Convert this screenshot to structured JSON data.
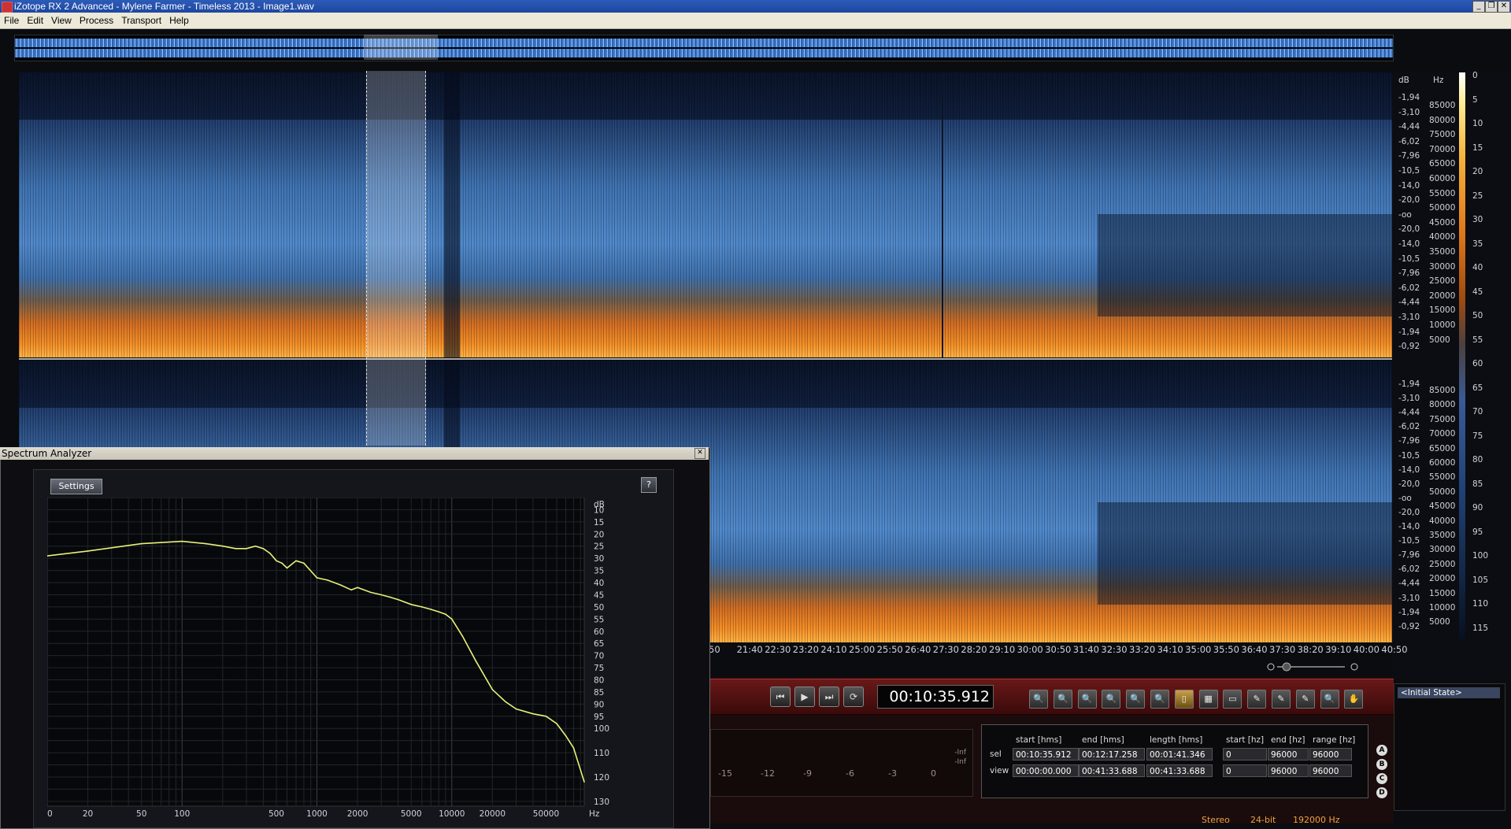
{
  "window": {
    "title": "iZotope RX 2 Advanced - Mylene Farmer - Timeless 2013 - Image1.wav",
    "controls": [
      "_",
      "❐",
      "✕"
    ]
  },
  "menu": [
    "File",
    "Edit",
    "View",
    "Process",
    "Transport",
    "Help"
  ],
  "scale": {
    "db_header": "dB",
    "hz_header": "Hz",
    "db_ticks_top": [
      "-1,94",
      "-3,10",
      "-4,44",
      "-6,02",
      "-7,96",
      "-10,5",
      "-14,0",
      "-20,0",
      "-oo",
      "-20,0",
      "-14,0",
      "-10,5",
      "-7,96",
      "-6,02",
      "-4,44",
      "-3,10",
      "-1,94",
      "-0,92"
    ],
    "db_ticks_bottom": [
      "-1,94",
      "-3,10",
      "-4,44",
      "-6,02",
      "-7,96",
      "-10,5",
      "-14,0",
      "-20,0",
      "-oo",
      "-20,0",
      "-14,0",
      "-10,5",
      "-7,96",
      "-6,02",
      "-4,44",
      "-3,10",
      "-1,94",
      "-0,92"
    ],
    "hz_ticks_top": [
      "85000",
      "80000",
      "75000",
      "70000",
      "65000",
      "60000",
      "55000",
      "50000",
      "45000",
      "40000",
      "35000",
      "30000",
      "25000",
      "20000",
      "15000",
      "10000",
      "5000"
    ],
    "hz_ticks_bottom": [
      "85000",
      "80000",
      "75000",
      "70000",
      "65000",
      "60000",
      "55000",
      "50000",
      "45000",
      "40000",
      "35000",
      "30000",
      "25000",
      "20000",
      "15000",
      "10000",
      "5000"
    ],
    "colorbar_ticks": [
      "0",
      "5",
      "10",
      "15",
      "20",
      "25",
      "30",
      "35",
      "40",
      "45",
      "50",
      "55",
      "60",
      "65",
      "70",
      "75",
      "80",
      "85",
      "90",
      "95",
      "100",
      "105",
      "110",
      "115"
    ]
  },
  "ruler": [
    "50",
    "21:40",
    "22:30",
    "23:20",
    "24:10",
    "25:00",
    "25:50",
    "26:40",
    "27:30",
    "28:20",
    "29:10",
    "30:00",
    "30:50",
    "31:40",
    "32:30",
    "33:20",
    "34:10",
    "35:00",
    "35:50",
    "36:40",
    "37:30",
    "38:20",
    "39:10",
    "40:00",
    "40:50"
  ],
  "transport": {
    "time": "00:10:35.912",
    "buttons": [
      "⏮",
      "▶",
      "⏭",
      "⟳"
    ],
    "tools": [
      "🔍",
      "🔍",
      "🔍",
      "🔍",
      "🔍",
      "🔍",
      "▯",
      "▦",
      "▭",
      "✎",
      "✎",
      "✎",
      "🔍",
      "✋"
    ]
  },
  "meter": {
    "ticks": [
      "-15",
      "-12",
      "-9",
      "-6",
      "-3",
      "0"
    ],
    "inf_labels": [
      "-Inf",
      "-Inf"
    ]
  },
  "selection_info": {
    "headers": [
      "start [hms]",
      "end [hms]",
      "length [hms]",
      "start [hz]",
      "end [hz]",
      "range [hz]"
    ],
    "rows": [
      {
        "label": "sel",
        "values": [
          "00:10:35.912",
          "00:12:17.258",
          "00:01:41.346",
          "0",
          "96000",
          "96000"
        ]
      },
      {
        "label": "view",
        "values": [
          "00:00:00.000",
          "00:41:33.688",
          "00:41:33.688",
          "0",
          "96000",
          "96000"
        ]
      }
    ],
    "abcd": [
      "A",
      "B",
      "C",
      "D"
    ]
  },
  "history": {
    "items": [
      "<Initial State>"
    ]
  },
  "status": {
    "channels": "Stereo",
    "bitdepth": "24-bit",
    "samplerate": "192000 Hz"
  },
  "spectrum_analyzer": {
    "title": "Spectrum Analyzer",
    "close": "✕",
    "settings_label": "Settings",
    "help_label": "?",
    "db_header": "dB",
    "hz_label": "Hz",
    "db_ticks": [
      "10",
      "15",
      "20",
      "25",
      "30",
      "35",
      "40",
      "45",
      "50",
      "55",
      "60",
      "65",
      "70",
      "75",
      "80",
      "85",
      "90",
      "95",
      "100",
      "110",
      "120",
      "130"
    ],
    "freq_ticks": [
      "10",
      "20",
      "50",
      "100",
      "500",
      "1000",
      "2000",
      "5000",
      "10000",
      "20000",
      "50000"
    ]
  },
  "chart_data": {
    "type": "line",
    "title": "",
    "xlabel": "Hz",
    "ylabel": "dB",
    "x_scale": "log",
    "xlim": [
      10,
      96000
    ],
    "ylim": [
      5,
      132
    ],
    "series": [
      {
        "color": "#e8f07a",
        "x": [
          10,
          20,
          50,
          100,
          150,
          200,
          250,
          300,
          350,
          400,
          450,
          500,
          550,
          600,
          700,
          800,
          1000,
          1200,
          1500,
          1800,
          2000,
          2500,
          3000,
          3500,
          4000,
          5000,
          6000,
          7000,
          8000,
          9000,
          10000,
          12000,
          15000,
          20000,
          25000,
          30000,
          40000,
          50000,
          60000,
          70000,
          80000,
          96000
        ],
        "values": [
          29,
          27,
          24,
          23,
          24,
          25,
          26,
          26,
          25,
          26,
          28,
          31,
          32,
          34,
          31,
          32,
          38,
          39,
          41,
          43,
          42,
          44,
          45,
          46,
          47,
          49,
          50,
          51,
          52,
          53,
          55,
          62,
          72,
          84,
          89,
          92,
          94,
          95,
          98,
          103,
          108,
          122
        ]
      }
    ]
  }
}
